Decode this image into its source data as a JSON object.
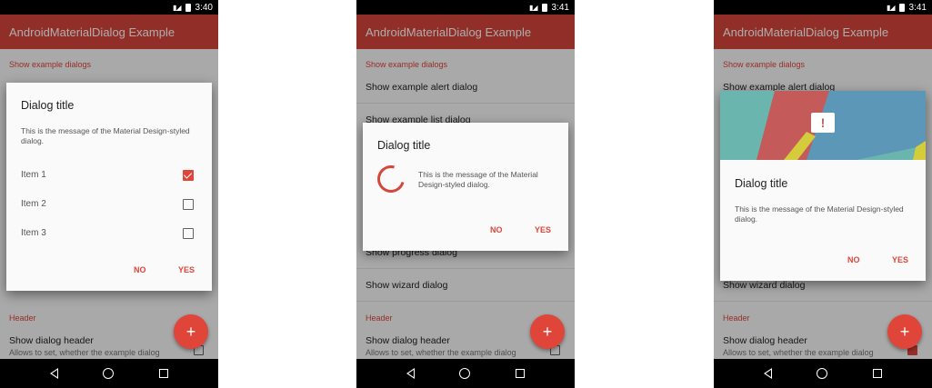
{
  "app": {
    "title": "AndroidMaterialDialog Example",
    "accent_color": "#e0453a",
    "toolbar_color": "#d6453a"
  },
  "screens": [
    {
      "time": "3:40",
      "list": {
        "section1": "Show example dialogs",
        "section2": "Header",
        "header_item": "Show dialog header",
        "header_sub": "Allows to set, whether the example dialog"
      },
      "dialog": {
        "title": "Dialog title",
        "message": "This is the message of the Material Design-styled dialog.",
        "items": [
          {
            "label": "Item 1",
            "checked": true
          },
          {
            "label": "Item 2",
            "checked": false
          },
          {
            "label": "Item 3",
            "checked": false
          }
        ],
        "negative": "NO",
        "positive": "YES"
      }
    },
    {
      "time": "3:41",
      "list": {
        "section1": "Show example dialogs",
        "item1": "Show example alert dialog",
        "item2": "Show example list dialog",
        "item_progress": "Show progress dialog",
        "item_wizard": "Show wizard dialog",
        "section2": "Header",
        "header_item": "Show dialog header",
        "header_sub": "Allows to set, whether the example dialog"
      },
      "dialog": {
        "title": "Dialog title",
        "message": "This is the message of the Material Design-styled dialog.",
        "negative": "NO",
        "positive": "YES"
      }
    },
    {
      "time": "3:41",
      "list": {
        "section1": "Show example dialogs",
        "item1": "Show example alert dialog",
        "item_wizard": "Show wizard dialog",
        "section2": "Header",
        "header_item": "Show dialog header",
        "header_sub": "Allows to set, whether the example dialog"
      },
      "dialog": {
        "header_icon": "!",
        "title": "Dialog title",
        "message": "This is the message of the Material Design-styled dialog.",
        "negative": "NO",
        "positive": "YES"
      }
    }
  ],
  "fab_icon": "+"
}
